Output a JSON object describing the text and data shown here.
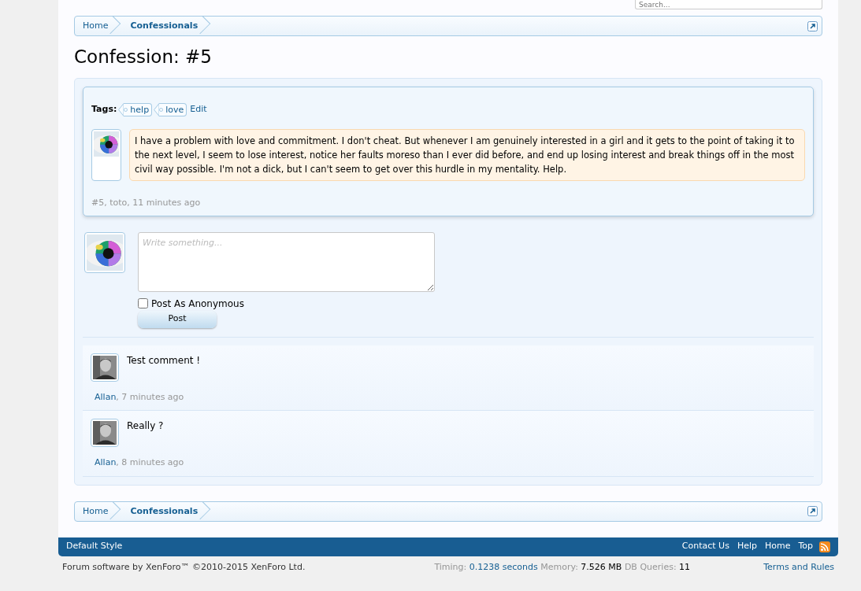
{
  "search": {
    "placeholder": "Search..."
  },
  "breadcrumbs": [
    {
      "label": "Home"
    },
    {
      "label": "Confessionals"
    }
  ],
  "title": "Confession: #5",
  "post": {
    "tags_label": "Tags:",
    "tags": [
      "help",
      "love"
    ],
    "edit": "Edit",
    "message": "I have a problem with love and commitment. I don't cheat. But whenever I am genuinely interested in a girl and it gets to the point of taking it to the next level, I seem to lose interest, notice her faults moreso than I ever did before, and end up losing interest and break things off in the most civil way possible. I'm not a dick, but I can't seem to get over this hurdle in my mentality. Help.",
    "meta": "#5, toto, 11 minutes ago"
  },
  "comment_form": {
    "placeholder": "Write something...",
    "anonymous": {
      "label": "Post As Anonymous",
      "checked": false
    },
    "submit": "Post"
  },
  "comments": [
    {
      "text": "Test comment !",
      "author": "Allan",
      "meta_rest": ", 7 minutes ago"
    },
    {
      "text": "Really ?",
      "author": "Allan",
      "meta_rest": ", 8 minutes ago"
    }
  ],
  "footer_breadcrumbs": [
    {
      "label": "Home"
    },
    {
      "label": "Confessionals"
    }
  ],
  "footer": {
    "style": "Default Style",
    "links": [
      "Contact Us",
      "Help",
      "Home",
      "Top"
    ]
  },
  "copyright": "Forum software by XenForo™ ©2010-2015 XenForo Ltd.",
  "debug": [
    {
      "label": "Timing:",
      "value": "0.1238 seconds",
      "kind": "link"
    },
    {
      "label": "Memory:",
      "value": "7.526 MB",
      "kind": "plain"
    },
    {
      "label": "DB Queries:",
      "value": "11",
      "kind": "plain"
    }
  ],
  "terms": "Terms and Rules"
}
